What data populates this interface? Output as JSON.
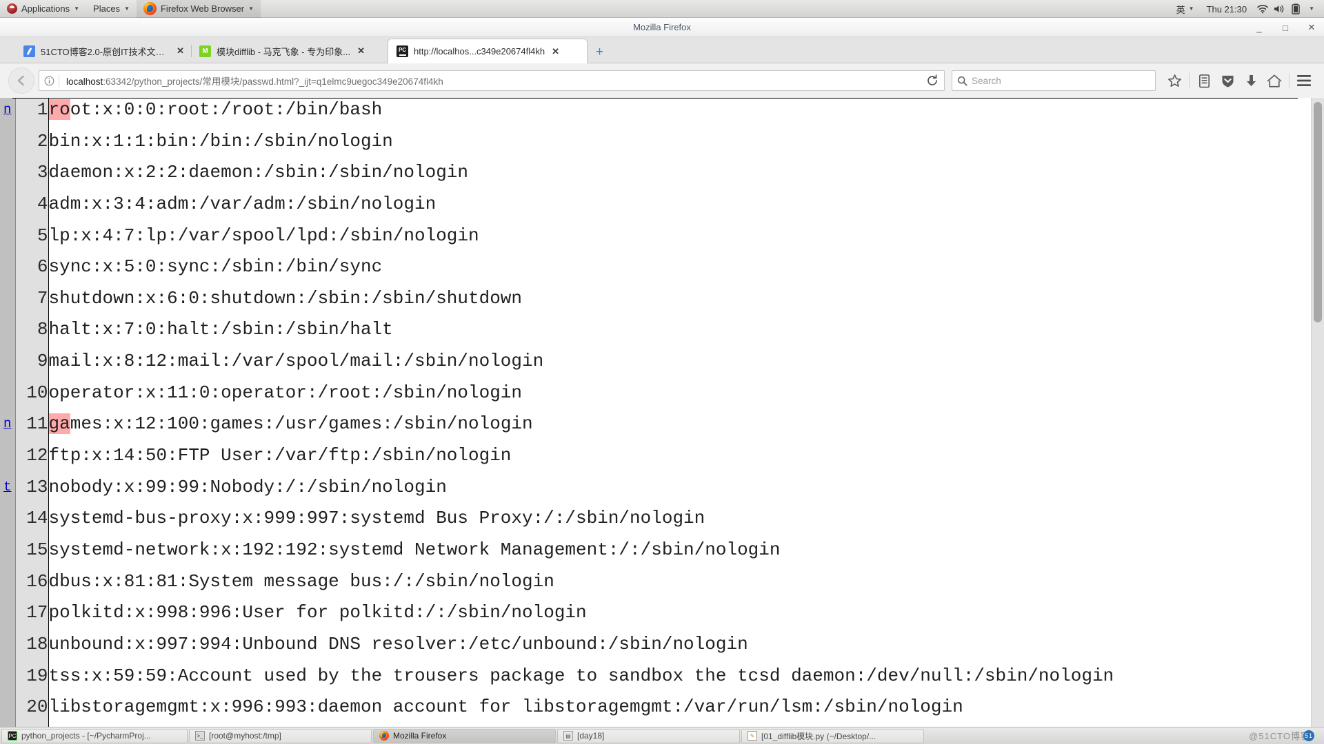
{
  "desktop_panel": {
    "logo_icon": "fedora-logo-icon",
    "menus": [
      {
        "label": "Applications",
        "icon": "fedora-logo-icon",
        "has_caret": true
      },
      {
        "label": "Places",
        "icon": "",
        "has_caret": true
      },
      {
        "label": "Firefox Web Browser",
        "icon": "firefox-icon",
        "has_caret": true
      }
    ],
    "tray": {
      "input_method": "英",
      "input_caret": "▼",
      "clock": "Thu 21:30",
      "icons": [
        "wifi-icon",
        "volume-icon",
        "battery-icon"
      ],
      "menu_caret": "▼"
    }
  },
  "window": {
    "title": "Mozilla Firefox",
    "minimize_label": "_",
    "maximize_label": "□",
    "close_label": "✕"
  },
  "tabs": [
    {
      "title": "51CTO博客2.0-原创IT技术文章...",
      "favicon": "feather-icon",
      "close_label": "✕",
      "selected": false
    },
    {
      "title": "模块difflib - 马克飞象 - 专为印象...",
      "favicon": "maxiang-icon",
      "close_label": "✕",
      "selected": false
    },
    {
      "title": "http://localhos...c349e20674fl4kh",
      "favicon": "pycharm-icon",
      "close_label": "✕",
      "selected": true
    }
  ],
  "new_tab_label": "+",
  "toolbar": {
    "back_icon": "back-arrow-icon",
    "identity_icon": "info-icon",
    "url_host": "localhost",
    "url_rest": ":63342/python_projects/常用模块/passwd.html?_ijt=q1elmc9uegoc349e20674fl4kh",
    "reload_icon": "reload-icon",
    "search_placeholder": "Search",
    "search_icon": "search-icon",
    "buttons": [
      {
        "icon": "bookmark-star-icon"
      },
      {
        "icon": "reader-list-icon"
      },
      {
        "icon": "pocket-shield-icon"
      },
      {
        "icon": "downloads-icon"
      },
      {
        "icon": "home-icon"
      },
      {
        "icon": "hamburger-menu-icon"
      }
    ]
  },
  "diff": {
    "nav_next_label": "n",
    "nav_top_label": "t",
    "rows": [
      {
        "nav": "n",
        "num": "1",
        "pre": "",
        "chg": "ro",
        "post": "ot:x:0:0:root:/root:/bin/bash"
      },
      {
        "nav": "",
        "num": "2",
        "pre": "bin:x:1:1:bin:/bin:/sbin/nologin",
        "chg": "",
        "post": ""
      },
      {
        "nav": "",
        "num": "3",
        "pre": "daemon:x:2:2:daemon:/sbin:/sbin/nologin",
        "chg": "",
        "post": ""
      },
      {
        "nav": "",
        "num": "4",
        "pre": "adm:x:3:4:adm:/var/adm:/sbin/nologin",
        "chg": "",
        "post": ""
      },
      {
        "nav": "",
        "num": "5",
        "pre": "lp:x:4:7:lp:/var/spool/lpd:/sbin/nologin",
        "chg": "",
        "post": ""
      },
      {
        "nav": "",
        "num": "6",
        "pre": "sync:x:5:0:sync:/sbin:/bin/sync",
        "chg": "",
        "post": ""
      },
      {
        "nav": "",
        "num": "7",
        "pre": "shutdown:x:6:0:shutdown:/sbin:/sbin/shutdown",
        "chg": "",
        "post": ""
      },
      {
        "nav": "",
        "num": "8",
        "pre": "halt:x:7:0:halt:/sbin:/sbin/halt",
        "chg": "",
        "post": ""
      },
      {
        "nav": "",
        "num": "9",
        "pre": "mail:x:8:12:mail:/var/spool/mail:/sbin/nologin",
        "chg": "",
        "post": ""
      },
      {
        "nav": "",
        "num": "10",
        "pre": "operator:x:11:0:operator:/root:/sbin/nologin",
        "chg": "",
        "post": ""
      },
      {
        "nav": "n",
        "num": "11",
        "pre": "",
        "chg": "ga",
        "post": "mes:x:12:100:games:/usr/games:/sbin/nologin"
      },
      {
        "nav": "",
        "num": "12",
        "pre": "ftp:x:14:50:FTP User:/var/ftp:/sbin/nologin",
        "chg": "",
        "post": ""
      },
      {
        "nav": "t",
        "num": "13",
        "pre": "nobody:x:99:99:Nobody:/:/sbin/nologin",
        "chg": "",
        "post": ""
      },
      {
        "nav": "",
        "num": "14",
        "pre": "systemd-bus-proxy:x:999:997:systemd Bus Proxy:/:/sbin/nologin",
        "chg": "",
        "post": ""
      },
      {
        "nav": "",
        "num": "15",
        "pre": "systemd-network:x:192:192:systemd Network Management:/:/sbin/nologin",
        "chg": "",
        "post": ""
      },
      {
        "nav": "",
        "num": "16",
        "pre": "dbus:x:81:81:System message bus:/:/sbin/nologin",
        "chg": "",
        "post": ""
      },
      {
        "nav": "",
        "num": "17",
        "pre": "polkitd:x:998:996:User for polkitd:/:/sbin/nologin",
        "chg": "",
        "post": ""
      },
      {
        "nav": "",
        "num": "18",
        "pre": "unbound:x:997:994:Unbound DNS resolver:/etc/unbound:/sbin/nologin",
        "chg": "",
        "post": ""
      },
      {
        "nav": "",
        "num": "19",
        "pre": "tss:x:59:59:Account used by the trousers package to sandbox the tcsd daemon:/dev/null:/sbin/nologin",
        "chg": "",
        "post": ""
      },
      {
        "nav": "",
        "num": "20",
        "pre": "libstoragemgmt:x:996:993:daemon account for libstoragemgmt:/var/run/lsm:/sbin/nologin",
        "chg": "",
        "post": ""
      }
    ]
  },
  "colors": {
    "diff_change_highlight": "#ffaaaa",
    "nav_gutter": "#c0c0c0",
    "number_gutter": "#e0e0e0",
    "link": "#0000cc"
  },
  "taskbar": {
    "items": [
      {
        "label": "python_projects - [~/PycharmProj...",
        "icon": "pycharm-icon",
        "active": false
      },
      {
        "label": "[root@myhost:/tmp]",
        "icon": "terminal-icon",
        "active": false
      },
      {
        "label": "Mozilla Firefox",
        "icon": "firefox-icon",
        "active": true
      },
      {
        "label": "[day18]",
        "icon": "document-icon",
        "active": false
      },
      {
        "label": "[01_difflib模块.py (~/Desktop/...",
        "icon": "note-icon",
        "active": false
      }
    ],
    "watermark": "@51CTO博客"
  }
}
